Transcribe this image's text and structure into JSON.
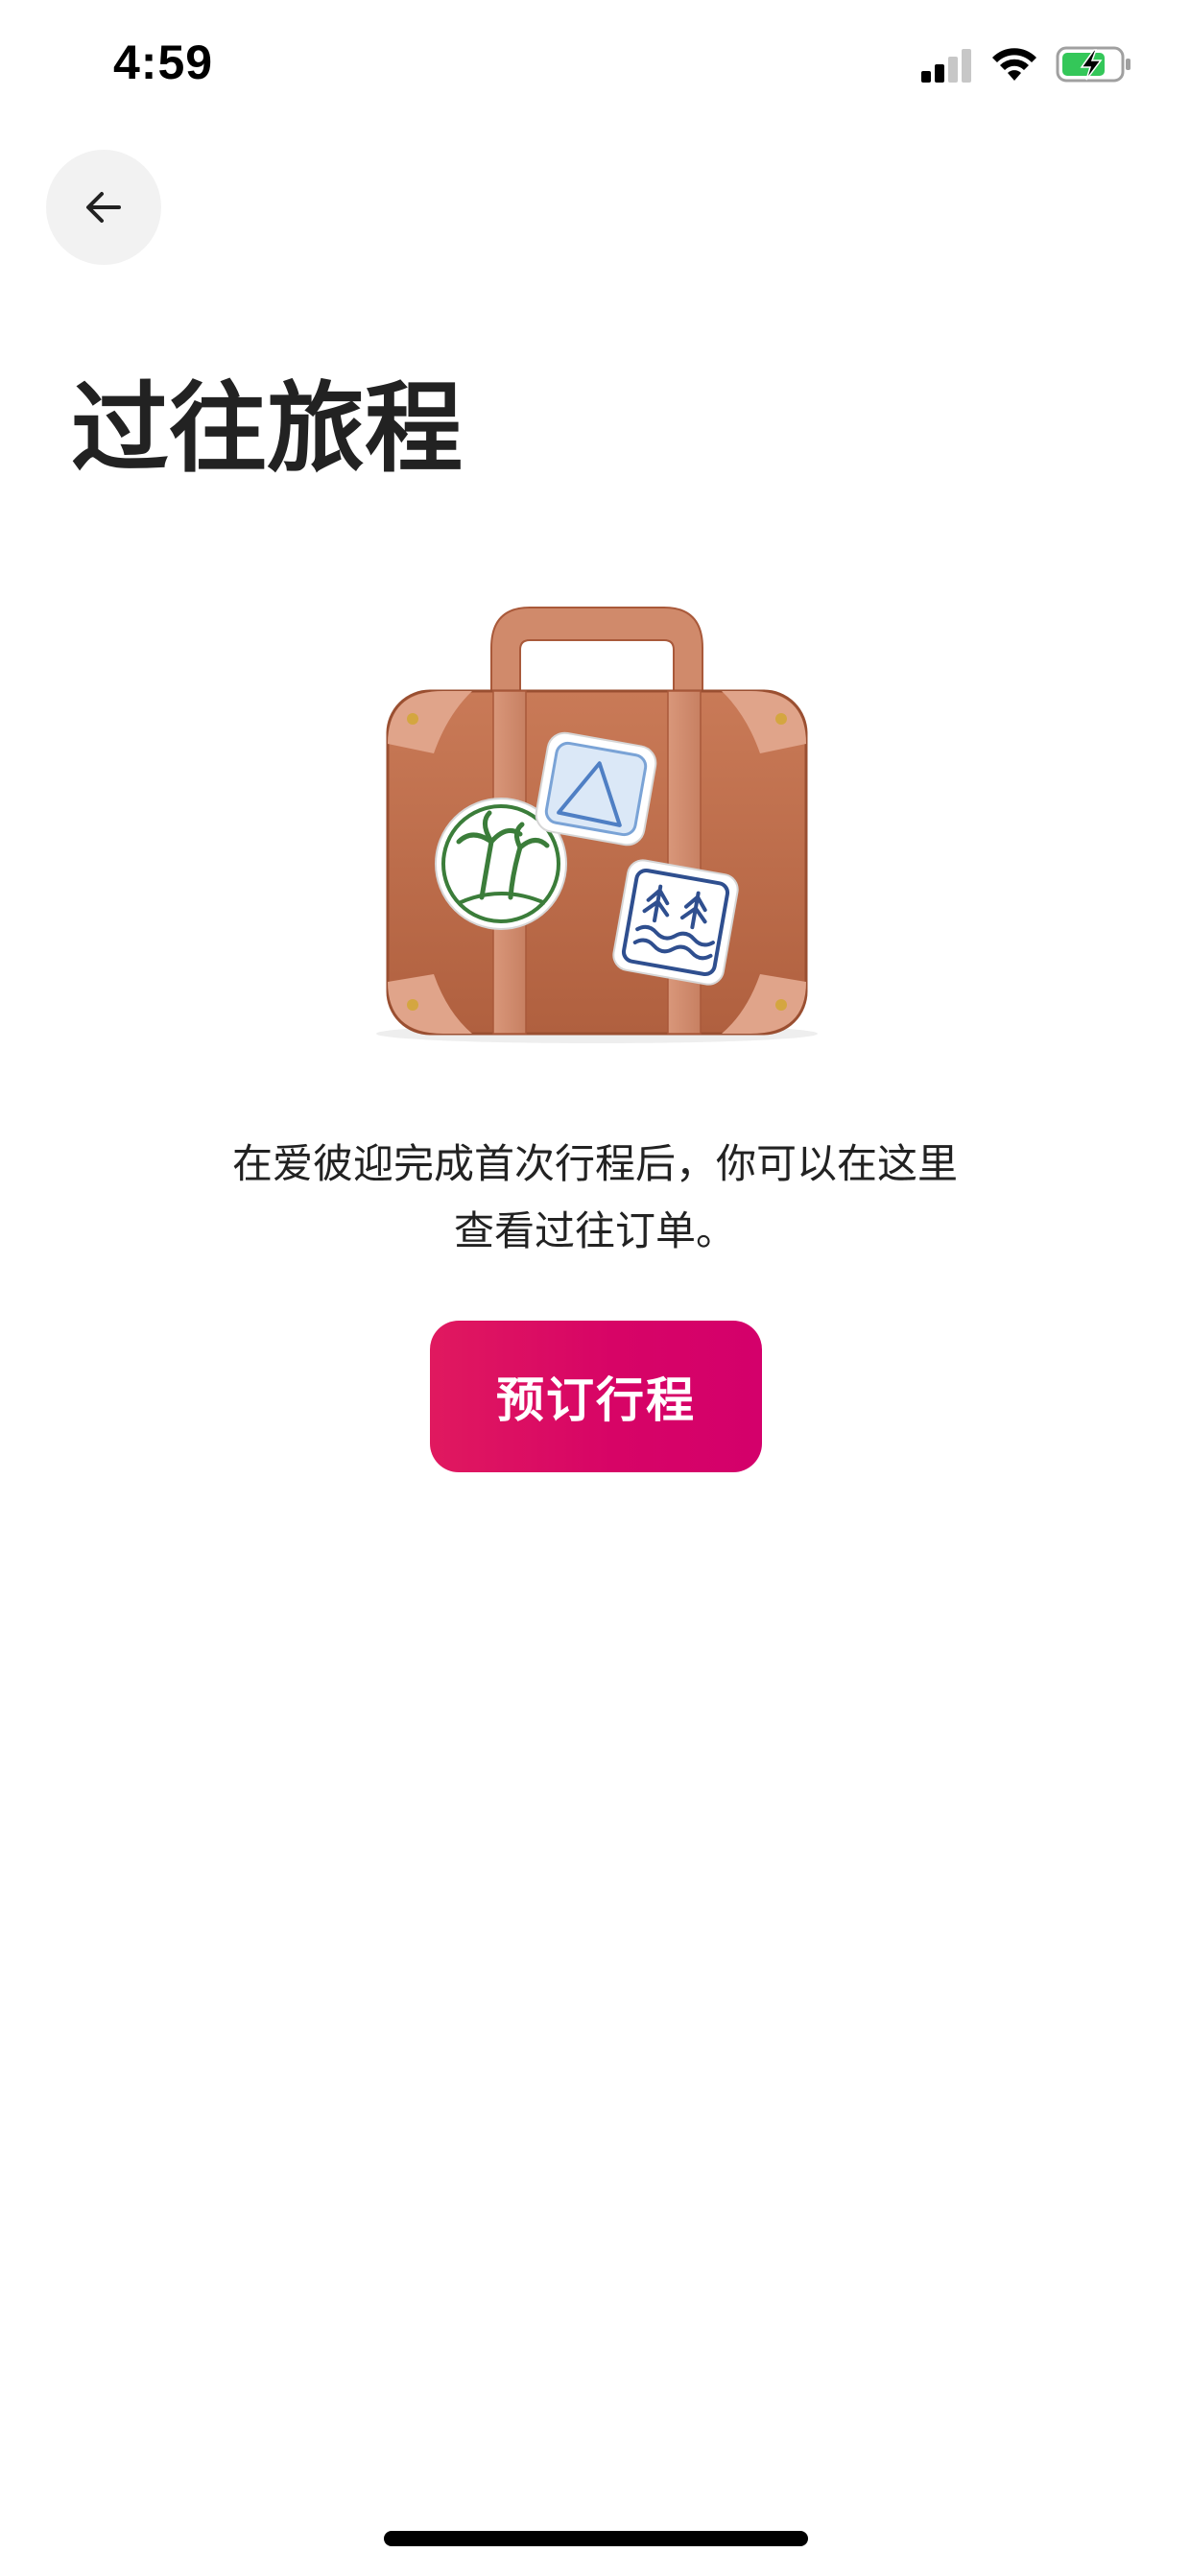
{
  "status_bar": {
    "time": "4:59",
    "icons": [
      "cellular-signal-icon",
      "wifi-icon",
      "battery-charging-icon"
    ],
    "battery_color": "#34c759"
  },
  "header": {
    "back_icon": "arrow-left-icon"
  },
  "main": {
    "title": "过往旅程",
    "illustration": "suitcase-with-stickers",
    "description_line1": "在爱彼迎完成首次行程后，你可以在这里",
    "description_line2": "查看过往订单。",
    "cta_label": "预订行程"
  },
  "colors": {
    "accent": "#d70466",
    "accent_start": "#e0195f",
    "text_primary": "#222222",
    "back_button_bg": "#f2f2f2"
  }
}
